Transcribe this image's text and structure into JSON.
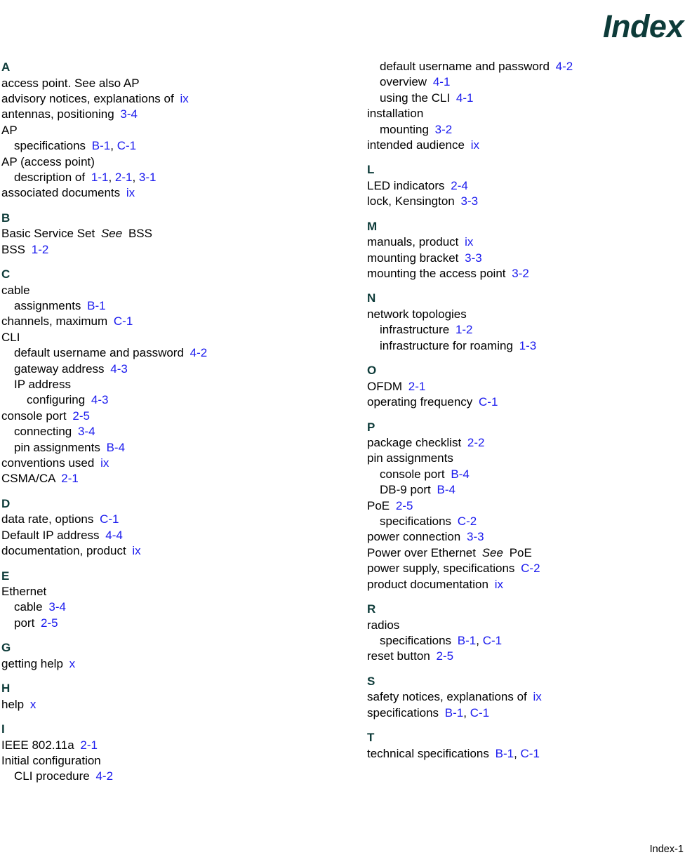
{
  "document": {
    "title": "Index",
    "footer_page_label": "Index-1"
  },
  "colors": {
    "heading": "#0d3b39",
    "reference_link": "#1a1aee",
    "body_text": "#000000",
    "background": "#ffffff"
  },
  "columns": [
    {
      "id": "left",
      "sections": [
        {
          "letter": "A",
          "entries": [
            {
              "level": 0,
              "term": "access point. See also AP",
              "refs": []
            },
            {
              "level": 0,
              "term": "advisory notices, explanations of",
              "refs": [
                "ix"
              ]
            },
            {
              "level": 0,
              "term": "antennas, positioning",
              "refs": [
                "3-4"
              ]
            },
            {
              "level": 0,
              "term": "AP",
              "refs": []
            },
            {
              "level": 1,
              "term": "specifications",
              "refs": [
                "B-1",
                "C-1"
              ]
            },
            {
              "level": 0,
              "term": "AP (access point)",
              "refs": []
            },
            {
              "level": 1,
              "term": "description of",
              "refs": [
                "1-1",
                "2-1",
                "3-1"
              ]
            },
            {
              "level": 0,
              "term": "associated documents",
              "refs": [
                "ix"
              ]
            }
          ]
        },
        {
          "letter": "B",
          "entries": [
            {
              "level": 0,
              "term": "Basic Service Set",
              "see": "See",
              "see_target": "BSS",
              "refs": []
            },
            {
              "level": 0,
              "term": "BSS",
              "refs": [
                "1-2"
              ]
            }
          ]
        },
        {
          "letter": "C",
          "entries": [
            {
              "level": 0,
              "term": "cable",
              "refs": []
            },
            {
              "level": 1,
              "term": "assignments",
              "refs": [
                "B-1"
              ]
            },
            {
              "level": 0,
              "term": "channels, maximum",
              "refs": [
                "C-1"
              ]
            },
            {
              "level": 0,
              "term": "CLI",
              "refs": []
            },
            {
              "level": 1,
              "term": "default username and password",
              "refs": [
                "4-2"
              ]
            },
            {
              "level": 1,
              "term": "gateway address",
              "refs": [
                "4-3"
              ]
            },
            {
              "level": 1,
              "term": "IP address",
              "refs": []
            },
            {
              "level": 2,
              "term": "configuring",
              "refs": [
                "4-3"
              ]
            },
            {
              "level": 0,
              "term": "console port",
              "refs": [
                "2-5"
              ]
            },
            {
              "level": 1,
              "term": "connecting",
              "refs": [
                "3-4"
              ]
            },
            {
              "level": 1,
              "term": "pin assignments",
              "refs": [
                "B-4"
              ]
            },
            {
              "level": 0,
              "term": "conventions used",
              "refs": [
                "ix"
              ]
            },
            {
              "level": 0,
              "term": "CSMA/CA",
              "refs": [
                "2-1"
              ]
            }
          ]
        },
        {
          "letter": "D",
          "entries": [
            {
              "level": 0,
              "term": "data rate, options",
              "refs": [
                "C-1"
              ]
            },
            {
              "level": 0,
              "term": "Default IP address",
              "refs": [
                "4-4"
              ]
            },
            {
              "level": 0,
              "term": "documentation, product",
              "refs": [
                "ix"
              ]
            }
          ]
        },
        {
          "letter": "E",
          "entries": [
            {
              "level": 0,
              "term": "Ethernet",
              "refs": []
            },
            {
              "level": 1,
              "term": "cable",
              "refs": [
                "3-4"
              ]
            },
            {
              "level": 1,
              "term": "port",
              "refs": [
                "2-5"
              ]
            }
          ]
        },
        {
          "letter": "G",
          "entries": [
            {
              "level": 0,
              "term": "getting help",
              "refs": [
                "x"
              ]
            }
          ]
        },
        {
          "letter": "H",
          "entries": [
            {
              "level": 0,
              "term": "help",
              "refs": [
                "x"
              ]
            }
          ]
        },
        {
          "letter": "I",
          "entries": [
            {
              "level": 0,
              "term": "IEEE 802.11a",
              "refs": [
                "2-1"
              ]
            },
            {
              "level": 0,
              "term": "Initial configuration",
              "refs": []
            },
            {
              "level": 1,
              "term": "CLI procedure",
              "refs": [
                "4-2"
              ]
            }
          ]
        }
      ]
    },
    {
      "id": "right",
      "sections": [
        {
          "letter": "",
          "continued": true,
          "entries": [
            {
              "level": 1,
              "term": "default username and password",
              "refs": [
                "4-2"
              ]
            },
            {
              "level": 1,
              "term": "overview",
              "refs": [
                "4-1"
              ]
            },
            {
              "level": 1,
              "term": "using the CLI",
              "refs": [
                "4-1"
              ]
            },
            {
              "level": 0,
              "term": "installation",
              "refs": []
            },
            {
              "level": 1,
              "term": "mounting",
              "refs": [
                "3-2"
              ]
            },
            {
              "level": 0,
              "term": "intended audience",
              "refs": [
                "ix"
              ]
            }
          ]
        },
        {
          "letter": "L",
          "entries": [
            {
              "level": 0,
              "term": "LED indicators",
              "refs": [
                "2-4"
              ]
            },
            {
              "level": 0,
              "term": "lock, Kensington",
              "refs": [
                "3-3"
              ]
            }
          ]
        },
        {
          "letter": "M",
          "entries": [
            {
              "level": 0,
              "term": "manuals, product",
              "refs": [
                "ix"
              ]
            },
            {
              "level": 0,
              "term": "mounting bracket",
              "refs": [
                "3-3"
              ]
            },
            {
              "level": 0,
              "term": "mounting the access point",
              "refs": [
                "3-2"
              ]
            }
          ]
        },
        {
          "letter": "N",
          "entries": [
            {
              "level": 0,
              "term": "network topologies",
              "refs": []
            },
            {
              "level": 1,
              "term": "infrastructure",
              "refs": [
                "1-2"
              ]
            },
            {
              "level": 1,
              "term": "infrastructure for roaming",
              "refs": [
                "1-3"
              ]
            }
          ]
        },
        {
          "letter": "O",
          "entries": [
            {
              "level": 0,
              "term": "OFDM",
              "refs": [
                "2-1"
              ]
            },
            {
              "level": 0,
              "term": "operating frequency",
              "refs": [
                "C-1"
              ]
            }
          ]
        },
        {
          "letter": "P",
          "entries": [
            {
              "level": 0,
              "term": "package checklist",
              "refs": [
                "2-2"
              ]
            },
            {
              "level": 0,
              "term": "pin assignments",
              "refs": []
            },
            {
              "level": 1,
              "term": "console port",
              "refs": [
                "B-4"
              ]
            },
            {
              "level": 1,
              "term": "DB-9 port",
              "refs": [
                "B-4"
              ]
            },
            {
              "level": 0,
              "term": "PoE",
              "refs": [
                "2-5"
              ]
            },
            {
              "level": 1,
              "term": "specifications",
              "refs": [
                "C-2"
              ]
            },
            {
              "level": 0,
              "term": "power connection",
              "refs": [
                "3-3"
              ]
            },
            {
              "level": 0,
              "term": "Power over Ethernet",
              "see": "See",
              "see_target": "PoE",
              "refs": []
            },
            {
              "level": 0,
              "term": "power supply, specifications",
              "refs": [
                "C-2"
              ]
            },
            {
              "level": 0,
              "term": "product documentation",
              "refs": [
                "ix"
              ]
            }
          ]
        },
        {
          "letter": "R",
          "entries": [
            {
              "level": 0,
              "term": "radios",
              "refs": []
            },
            {
              "level": 1,
              "term": "specifications",
              "refs": [
                "B-1",
                "C-1"
              ]
            },
            {
              "level": 0,
              "term": "reset button",
              "refs": [
                "2-5"
              ]
            }
          ]
        },
        {
          "letter": "S",
          "entries": [
            {
              "level": 0,
              "term": "safety notices, explanations of",
              "refs": [
                "ix"
              ]
            },
            {
              "level": 0,
              "term": "specifications",
              "refs": [
                "B-1",
                "C-1"
              ]
            }
          ]
        },
        {
          "letter": "T",
          "entries": [
            {
              "level": 0,
              "term": "technical specifications",
              "refs": [
                "B-1",
                "C-1"
              ]
            }
          ]
        }
      ]
    }
  ]
}
